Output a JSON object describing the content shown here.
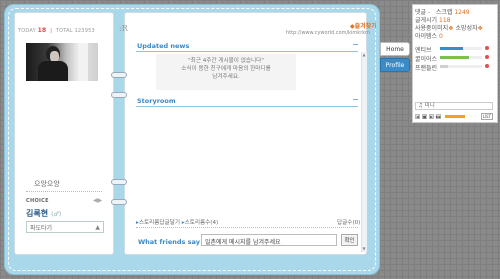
{
  "header": {
    "today_label": "TODAY",
    "today_value": "18",
    "separator": "|",
    "total_label": "TOTAL",
    "total_value": "123953",
    "logo_glyph": ":R",
    "favorite": "◆즐겨찾기",
    "url": "http://www.cyworld.com/kimkrkm"
  },
  "left": {
    "nickname": "으앙으앙",
    "choice_title": "CHOICE",
    "choice_arrows": "◀▶",
    "owner_name": "김록현",
    "owner_gender": "(♂)",
    "pado_label": "파도타기",
    "pado_arrow": "▲"
  },
  "updated_news": {
    "title": "Updated news",
    "minus": "−",
    "message_line1": "\"최근 4주간 게시물이 없습니다\"",
    "message_line2": "소식이 뜸한 친구에게 마음의 한마디를",
    "message_line3": "남겨주세요."
  },
  "storyroom": {
    "title": "Storyroom",
    "minus": "−",
    "footer_bullet": "▸",
    "footer_reply": "스토리룸답글달기",
    "footer_separator": " ▸",
    "footer_count": "스토리룸수(4)",
    "reply_count": "답글수(0)"
  },
  "friends_say": {
    "label": "What friends say",
    "input_value": "일촌에게 메시지를 남겨주세요",
    "confirm": "확인"
  },
  "tabs": {
    "home": "Home",
    "profile": "Profile"
  },
  "info": {
    "reply_label": "댓글",
    "reply_value": "-",
    "scrap_label": "스크랩",
    "scrap_value": "1249",
    "posts_label": "글게시기",
    "posts_value": "118",
    "photo_label": "사용중이미지",
    "photo_icon": "❖",
    "photo_extra": "소망성자",
    "photo_extra_icon": "❖",
    "items_label": "아이템스",
    "items_value": "0",
    "stats": [
      {
        "label": "엔티브",
        "color": "#3a8cc8",
        "fill": 0.55
      },
      {
        "label": "꿀이어스",
        "color": "#7cc050",
        "fill": 0.7
      },
      {
        "label": "프랜들린",
        "color": "#d0d0d0",
        "fill": 0.2
      }
    ],
    "music": "♫ 미니",
    "player_controls": [
      "◀",
      "■",
      "▶",
      "▶▶"
    ],
    "list_label": "LIST"
  },
  "colors": {
    "accent_blue": "#3a88c6",
    "accent_orange": "#e07020",
    "frame_blue": "#a9d8ea"
  }
}
